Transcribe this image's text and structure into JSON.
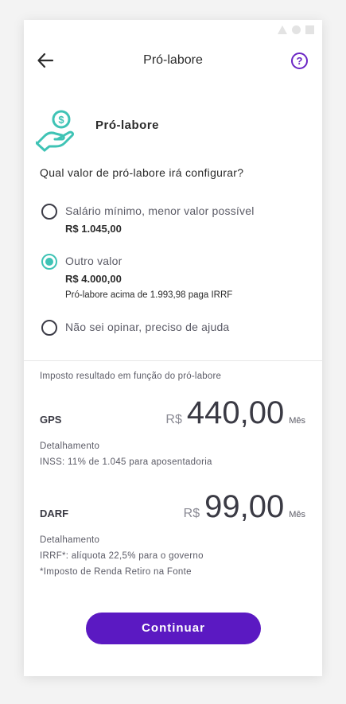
{
  "header": {
    "title": "Pró-labore",
    "back_icon": "arrow-left-icon",
    "help_icon": "question-circle-icon",
    "help_glyph": "?"
  },
  "hero": {
    "title": "Pró-labore",
    "icon": "hand-coin-icon"
  },
  "question": "Qual valor de pró-labore irá configurar?",
  "options": [
    {
      "label": "Salário mínimo, menor valor possível",
      "value": "R$ 1.045,00",
      "note": "",
      "selected": false
    },
    {
      "label": "Outro valor",
      "value": "R$ 4.000,00",
      "note": "Pró-labore acima de 1.993,98 paga IRRF",
      "selected": true
    },
    {
      "label": "Não sei opinar, preciso de ajuda",
      "value": "",
      "note": "",
      "selected": false
    }
  ],
  "result": {
    "section_label": "Imposto resultado em função do pró-labore",
    "gps": {
      "name": "GPS",
      "currency": "R$",
      "amount": "440,00",
      "period": "Mês",
      "detail_title": "Detalhamento",
      "detail_lines": [
        "INSS: 11% de 1.045 para aposentadoria"
      ]
    },
    "darf": {
      "name": "DARF",
      "currency": "R$",
      "amount": "99,00",
      "period": "Mês",
      "detail_title": "Detalhamento",
      "detail_lines": [
        "IRRF*: alíquota 22,5% para o governo",
        "*Imposto de Renda Retiro na Fonte"
      ]
    }
  },
  "continue_label": "Continuar",
  "colors": {
    "accent": "#5b19c2",
    "teal": "#3fc3b5",
    "help": "#6a25c4"
  }
}
